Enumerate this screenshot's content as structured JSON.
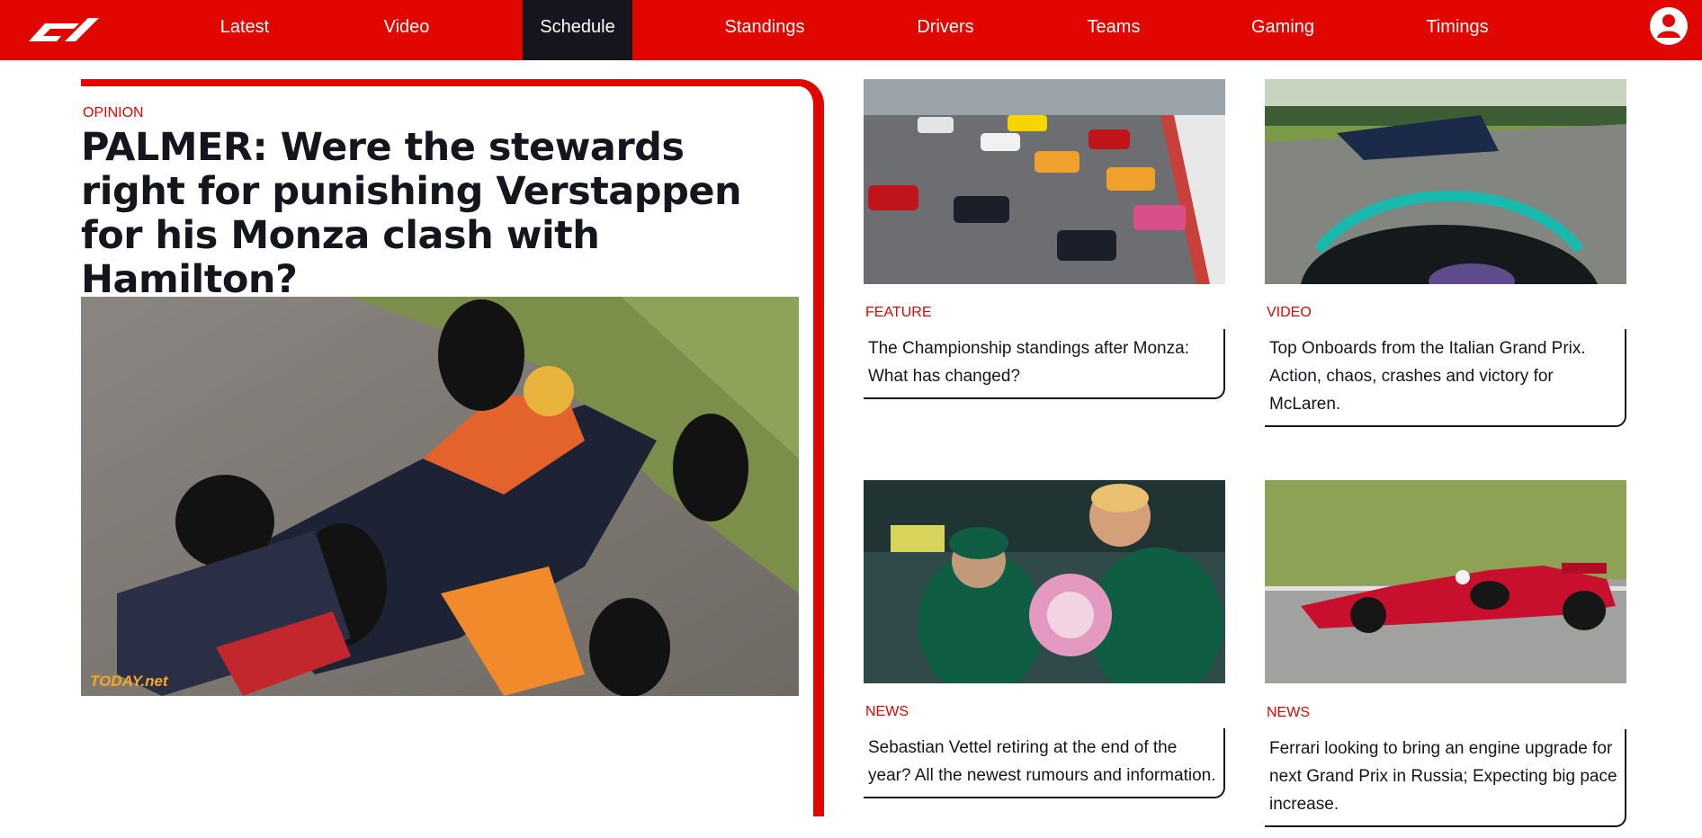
{
  "nav": {
    "items": [
      {
        "label": "Latest"
      },
      {
        "label": "Video"
      },
      {
        "label": "Schedule"
      },
      {
        "label": "Standings"
      },
      {
        "label": "Drivers"
      },
      {
        "label": "Teams"
      },
      {
        "label": "Gaming"
      },
      {
        "label": "Timings"
      }
    ],
    "active": "Schedule",
    "logo_icon": "f1-logo",
    "account_icon": "user-account-icon"
  },
  "colors": {
    "brand_red": "#e10600",
    "nav_active": "#15151e",
    "text": "#15151e"
  },
  "main": {
    "tag": "OPINION",
    "title": "PALMER: Were the stewards right for punishing Verstappen for his Monza clash with Hamilton?",
    "image_credit": "TODAY.net"
  },
  "cards": [
    {
      "tag": "FEATURE",
      "text": "The Championship standings after Monza: What has changed?"
    },
    {
      "tag": "VIDEO",
      "text": "Top Onboards from the Italian Grand Prix. Action, chaos, crashes and victory for McLaren."
    },
    {
      "tag": "NEWS",
      "text": "Sebastian Vettel retiring at the end of the year? All the newest rumours and information."
    },
    {
      "tag": "NEWS",
      "text": "Ferrari looking to bring an engine upgrade for next Grand Prix in Russia; Expecting big pace increase."
    }
  ]
}
